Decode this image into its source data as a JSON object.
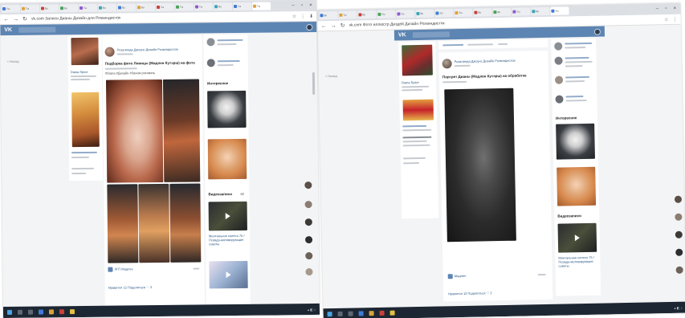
{
  "left": {
    "tabs": [
      {
        "label": "Tur"
      },
      {
        "label": "Tur"
      },
      {
        "label": "Bu"
      },
      {
        "label": "Bu"
      },
      {
        "label": "Tur"
      },
      {
        "label": "Bu"
      },
      {
        "label": "Bu"
      },
      {
        "label": "Bu"
      },
      {
        "label": "Tur"
      },
      {
        "label": "Tur"
      },
      {
        "label": "Tur"
      },
      {
        "label": "Bu"
      },
      {
        "label": "Tur"
      },
      {
        "label": "Tur"
      }
    ],
    "window_controls": {
      "minimize": "–",
      "maximize": "▫",
      "close": "×"
    },
    "url": "vk.com  Записи Дианы Дизайн для Розкиндисток",
    "vk_logo": "VK",
    "side_menu": "< Назад",
    "profile_name": "Diana Spice",
    "post_author": "Розалинда Джоунс Дизайн Розкиндистов",
    "post_title": "Подборка фото Ловицы (Мадлен Кутэрш) на фото",
    "post_tags": "#Diana #Дизайн #Зачем рисовать",
    "post_link": "ЛГП Мадлен",
    "post_actions": "Нравится 12   Поделиться   ♡ 3",
    "right_header_1": "Интересное",
    "right_header_2": "Видеозаписи",
    "video_caption": "Ментальное колесо 75 / Псевдо-мотивирующие советы",
    "video_count": "68"
  },
  "right": {
    "tabs": [
      {
        "label": "Bu"
      },
      {
        "label": "Tur"
      },
      {
        "label": "Bu"
      },
      {
        "label": "Tur"
      },
      {
        "label": "Tur"
      },
      {
        "label": "Bu"
      },
      {
        "label": "Tur"
      },
      {
        "label": "Tur"
      },
      {
        "label": "Bu"
      },
      {
        "label": "Bu"
      },
      {
        "label": "Tur"
      },
      {
        "label": "Bu"
      },
      {
        "label": "Tur"
      }
    ],
    "window_controls": {
      "minimize": "–",
      "maximize": "▫",
      "close": "×"
    },
    "url": "vk.com  Фото иллюстр Диздей Дизайн Розкиндисток",
    "vk_logo": "VK",
    "side_menu": "< Назад",
    "profile_name": "Diana Spice",
    "post_author": "Розалинда Джоунс Дизайн Розкиндистов",
    "post_text": "Портрет Дианы (Мадлен Кутэрш) на обработке",
    "post_link": "Мадлен",
    "post_actions": "Нравится 13   Поделиться   ♡ 2",
    "right_header_1": "Интересное",
    "right_header_2": "Видеозаписи",
    "video_caption": "Ментальное колесо 75 / Псевдо-мотивирующие советы"
  },
  "colors": {
    "vk_blue": "#5d85b3",
    "taskbar": "#1d2733",
    "link": "#2a5885"
  }
}
